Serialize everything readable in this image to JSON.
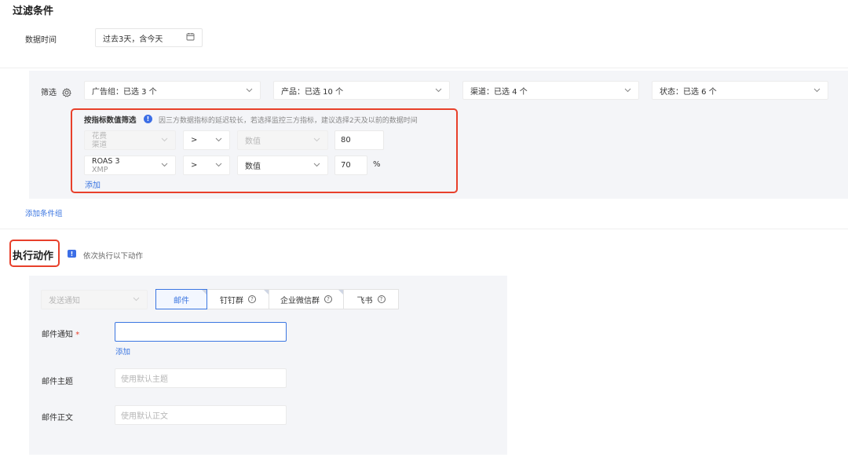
{
  "filter": {
    "title": "过滤条件",
    "data_time_label": "数据时间",
    "data_time_value": "过去3天，含今天",
    "screen_label": "筛选",
    "dropdowns": [
      {
        "label": "广告组：已选 3 个"
      },
      {
        "label": "产品：已选 10 个"
      },
      {
        "label": "渠道：已选 4 个"
      },
      {
        "label": "状态：已选 6 个"
      }
    ],
    "metric": {
      "title": "按指标数值筛选",
      "info": "因三方数据指标的延迟较长，若选择监控三方指标，建议选择2天及以前的数据时间",
      "rows": [
        {
          "metric_line1": "花费",
          "metric_line2": "渠道",
          "op": ">",
          "value_type": "数值",
          "value": "80",
          "unit": "",
          "disabled": true
        },
        {
          "metric_line1": "ROAS 3",
          "metric_line2": "XMP",
          "op": ">",
          "value_type": "数值",
          "value": "70",
          "unit": "%",
          "disabled": false
        }
      ],
      "add_label": "添加"
    },
    "add_group_label": "添加条件组"
  },
  "action": {
    "title": "执行动作",
    "hint": "依次执行以下动作",
    "notify_select": "发送通知",
    "tabs": [
      {
        "label": "邮件",
        "active": true,
        "help": false
      },
      {
        "label": "钉钉群",
        "active": false,
        "help": true
      },
      {
        "label": "企业微信群",
        "active": false,
        "help": true
      },
      {
        "label": "飞书",
        "active": false,
        "help": true
      }
    ],
    "email_notify_label": "邮件通知",
    "required_mark": "*",
    "email_add_label": "添加",
    "subject_label": "邮件主题",
    "subject_placeholder": "使用默认主题",
    "body_label": "邮件正文",
    "body_placeholder": "使用默认正文"
  },
  "icons": {
    "calendar": "calendar-icon",
    "gear": "gear-icon",
    "chevron": "chevron-down-icon",
    "info": "info-icon",
    "help": "help-circle-icon",
    "flag": "flag-icon"
  },
  "colors": {
    "accent": "#3b76e1",
    "highlight_border": "#e8402b",
    "panel_bg": "#f4f5f8"
  }
}
